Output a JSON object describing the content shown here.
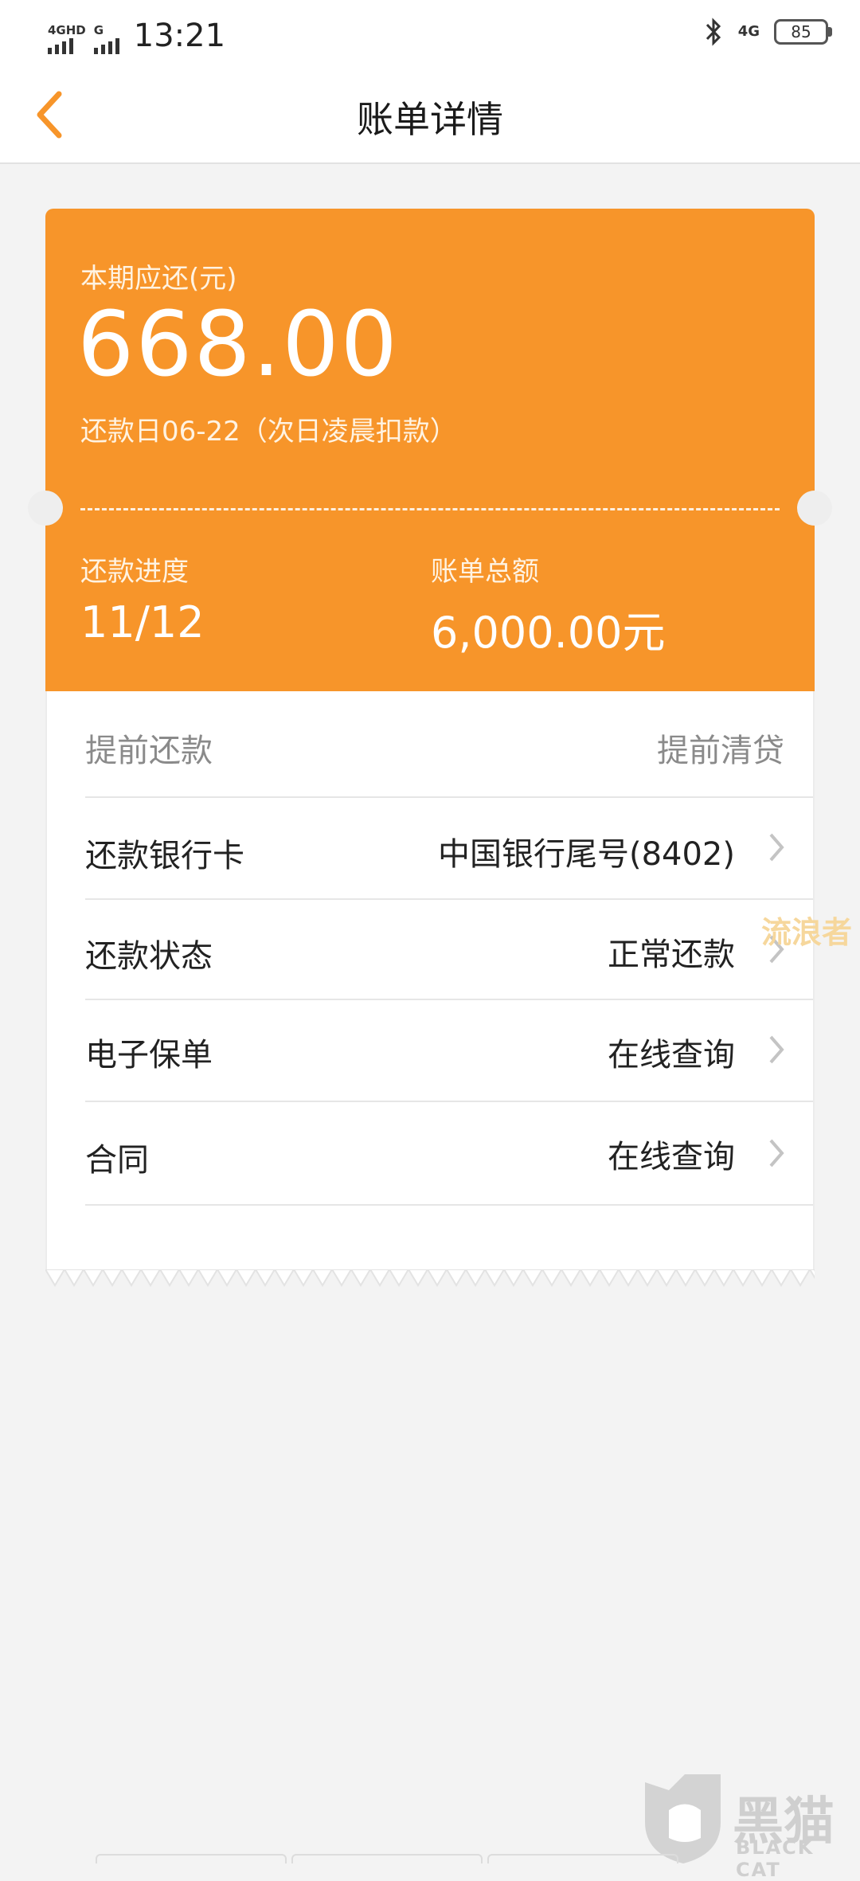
{
  "status_bar": {
    "sim1_label": "4GHD",
    "sim2_label": "G",
    "time": "13:21",
    "network": "4G",
    "battery": "85"
  },
  "nav": {
    "back_icon": "chevron-left-icon",
    "title": "账单详情"
  },
  "colors": {
    "accent": "#f7952a",
    "background": "#f3f3f3"
  },
  "bill": {
    "due_label": "本期应还(元)",
    "due_amount": "668.00",
    "due_date": "还款日06-22（次日凌晨扣款）",
    "progress_label": "还款进度",
    "progress_value": "11/12",
    "total_label": "账单总额",
    "total_value": "6,000.00元"
  },
  "actions": {
    "prepay": "提前还款",
    "payoff": "提前清贷"
  },
  "rows": [
    {
      "label": "还款银行卡",
      "value": "中国银行尾号(8402)"
    },
    {
      "label": "还款状态",
      "value": "正常还款"
    },
    {
      "label": "电子保单",
      "value": "在线查询"
    },
    {
      "label": "合同",
      "value": "在线查询"
    }
  ],
  "watermark": "流浪者",
  "logo": {
    "text": "黑猫",
    "sub": "BLACK CAT"
  }
}
